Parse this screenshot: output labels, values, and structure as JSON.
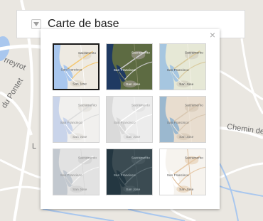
{
  "basemap": {
    "title": "Carte de base"
  },
  "map_labels": [
    "rreyrot",
    "du Pontet",
    "Chemin de",
    "L"
  ],
  "gallery": {
    "close_symbol": "×",
    "thumb_place_labels": [
      "Sacramento",
      "San Francisco",
      "San Jose"
    ],
    "selected_index": 0,
    "styles": [
      {
        "id": "streets",
        "land": "#eeeae2",
        "water": "#a9c7ee",
        "road": "#f4c872",
        "road2": "#ffffff",
        "text": "#555555",
        "urban": "#e2dccf"
      },
      {
        "id": "imagery",
        "land": "#5d6b42",
        "water": "#1f3a62",
        "road": "#c9c9c9",
        "road2": "#8b8f6a",
        "text": "#ffffff",
        "urban": "#8a8a78"
      },
      {
        "id": "topographic",
        "land": "#e6e8d6",
        "water": "#a6c6e0",
        "road": "#d8c99c",
        "road2": "#f4f1e6",
        "text": "#4a4a4a",
        "urban": "#d8d6c6"
      },
      {
        "id": "navigation",
        "land": "#f1f0ee",
        "water": "#c9d4ea",
        "road": "#dcdcdc",
        "road2": "#ffffff",
        "text": "#8a8a8a",
        "urban": "#e7e5e1"
      },
      {
        "id": "light-gray",
        "land": "#ececec",
        "water": "#dadada",
        "road": "#ffffff",
        "road2": "#f6f6f6",
        "text": "#9a9a9a",
        "urban": "#e3e3e3"
      },
      {
        "id": "oceans",
        "land": "#e8ddcf",
        "water": "#9bb8cf",
        "road": "#d9c8b2",
        "road2": "#efe6da",
        "text": "#6f6f6f",
        "urban": "#dccfbe"
      },
      {
        "id": "terrain",
        "land": "#e2e2e2",
        "water": "#c2c8cf",
        "road": "#f4f4f4",
        "road2": "#d6d6d6",
        "text": "#8a8a8a",
        "urban": "#d6d6d6"
      },
      {
        "id": "dark-gray",
        "land": "#3b4b52",
        "water": "#243741",
        "road": "#5d6d74",
        "road2": "#4a5a61",
        "text": "#b8c3c7",
        "urban": "#45555c"
      },
      {
        "id": "national-geographic",
        "land": "#f6f3ee",
        "water": "#ffffff",
        "road": "#e6c9a8",
        "road2": "#d9b48c",
        "text": "#555555",
        "urban": "#ecdcc8"
      }
    ]
  }
}
